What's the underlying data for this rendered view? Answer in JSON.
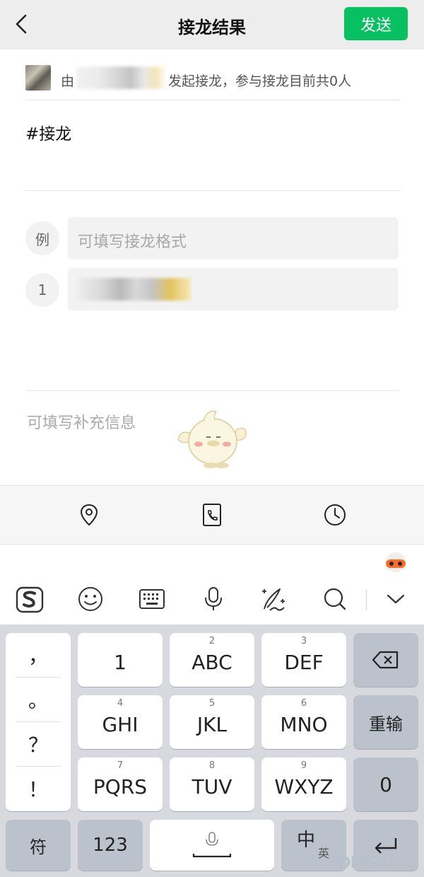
{
  "header": {
    "title": "接龙结果",
    "send_label": "发送",
    "colors": {
      "send_bg": "#07c160",
      "bar_bg": "#ededed"
    }
  },
  "initiator": {
    "prefix": "由",
    "suffix": "发起接龙，参与接龙目前共0人"
  },
  "topic": {
    "hashtag": "#接龙"
  },
  "entries": [
    {
      "badge": "例",
      "placeholder": "可填写接龙格式"
    },
    {
      "badge": "1",
      "value": ""
    }
  ],
  "supplement": {
    "placeholder": "可填写补充信息"
  },
  "toolbar": {
    "icons": [
      "location-icon",
      "phone-icon",
      "clock-icon"
    ]
  },
  "ime": {
    "icons": [
      "sogou-logo-icon",
      "emoji-icon",
      "keyboard-icon",
      "microphone-icon",
      "handwriting-icon",
      "search-icon",
      "collapse-chevron-icon"
    ]
  },
  "keyboard": {
    "punctuation": [
      "，",
      "。",
      "？",
      "！"
    ],
    "keys": [
      {
        "num": "",
        "label": "1"
      },
      {
        "num": "2",
        "label": "ABC"
      },
      {
        "num": "3",
        "label": "DEF"
      },
      {
        "num": "4",
        "label": "GHI"
      },
      {
        "num": "5",
        "label": "JKL"
      },
      {
        "num": "6",
        "label": "MNO"
      },
      {
        "num": "7",
        "label": "PQRS"
      },
      {
        "num": "8",
        "label": "TUV"
      },
      {
        "num": "9",
        "label": "WXYZ"
      }
    ],
    "reinput": "重输",
    "zero": "0",
    "symbol": "符",
    "numeric": "123",
    "lang_main": "中",
    "lang_sub": "英"
  },
  "watermark": "3DMGAME"
}
